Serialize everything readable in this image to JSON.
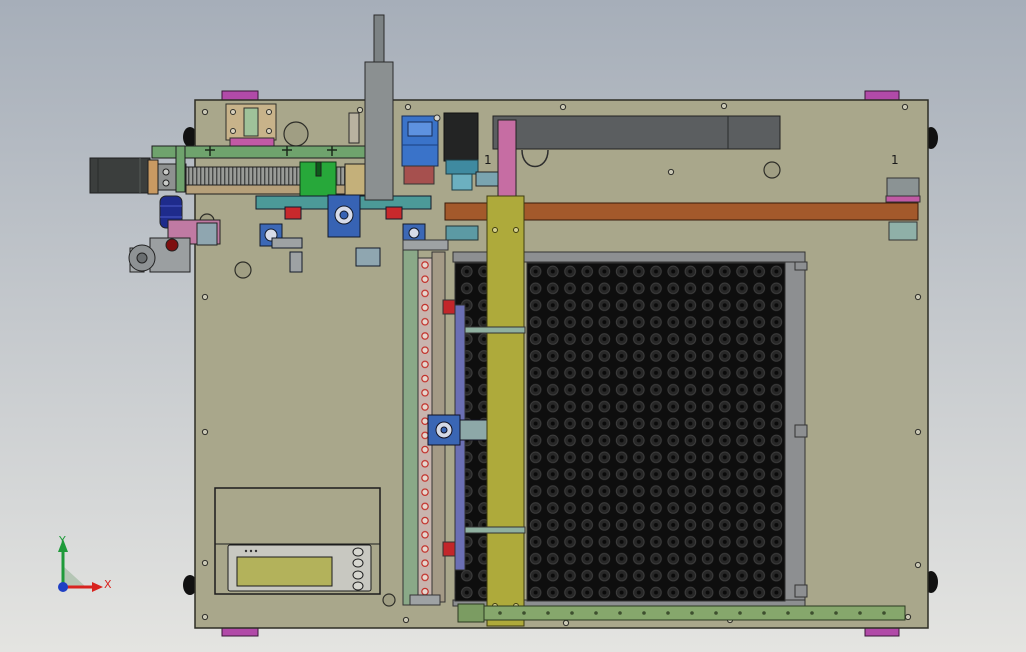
{
  "viewport": {
    "background_top": "#a6aeb9",
    "background_bottom": "#e4e4e1"
  },
  "colors": {
    "base_plate": "#a9a78b",
    "tray_grid": "#121212",
    "gantry_beam": "#a3592b",
    "vertical_beam": "#aeaa3b",
    "mounting_tab": "#b14aa8",
    "lcd_screen": "#b3b25b"
  },
  "part_labels": [
    "1",
    "1"
  ],
  "triad": {
    "x_label": "X",
    "y_label": "Y",
    "x_color": "#d8231f",
    "y_color": "#1f9a3a",
    "z_color": "#1f3fc4"
  }
}
